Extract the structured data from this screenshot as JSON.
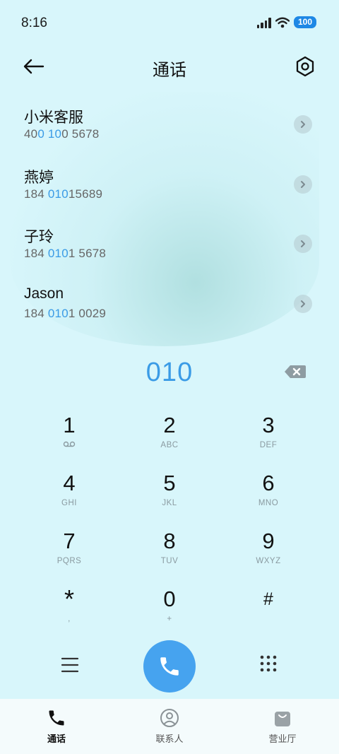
{
  "status_bar": {
    "time": "8:16",
    "battery": "100"
  },
  "header": {
    "title": "通话"
  },
  "results": [
    {
      "name": "小米客服",
      "number_parts": [
        {
          "t": "40",
          "h": false
        },
        {
          "t": "0",
          "h": true
        },
        {
          "t": " ",
          "h": false
        },
        {
          "t": "10",
          "h": true
        },
        {
          "t": "0 5678",
          "h": false
        }
      ]
    },
    {
      "name": "燕婷",
      "number_parts": [
        {
          "t": "184 ",
          "h": false
        },
        {
          "t": "010",
          "h": true
        },
        {
          "t": "15689",
          "h": false
        }
      ]
    },
    {
      "name": "子玲",
      "number_parts": [
        {
          "t": "184 ",
          "h": false
        },
        {
          "t": "010",
          "h": true
        },
        {
          "t": "1 5678",
          "h": false
        }
      ]
    },
    {
      "name": "Jason",
      "number_parts": [
        {
          "t": "184 ",
          "h": false
        },
        {
          "t": "010",
          "h": true
        },
        {
          "t": "1 0029",
          "h": false
        }
      ]
    }
  ],
  "dial": {
    "value": "010"
  },
  "keys": [
    {
      "digit": "1",
      "letters": ""
    },
    {
      "digit": "2",
      "letters": "ABC"
    },
    {
      "digit": "3",
      "letters": "DEF"
    },
    {
      "digit": "4",
      "letters": "GHI"
    },
    {
      "digit": "5",
      "letters": "JKL"
    },
    {
      "digit": "6",
      "letters": "MNO"
    },
    {
      "digit": "7",
      "letters": "PQRS"
    },
    {
      "digit": "8",
      "letters": "TUV"
    },
    {
      "digit": "9",
      "letters": "WXYZ"
    },
    {
      "digit": "*",
      "letters": ","
    },
    {
      "digit": "0",
      "letters": "+"
    },
    {
      "digit": "#",
      "letters": ""
    }
  ],
  "nav": [
    {
      "label": "通话",
      "icon": "phone-icon",
      "active": true
    },
    {
      "label": "联系人",
      "icon": "contact-icon",
      "active": false
    },
    {
      "label": "营业厅",
      "icon": "shopping-bag-icon",
      "active": false
    }
  ],
  "colors": {
    "accent": "#3a9be6",
    "call_button": "#46a3ef",
    "background": "#d8f6fb"
  }
}
